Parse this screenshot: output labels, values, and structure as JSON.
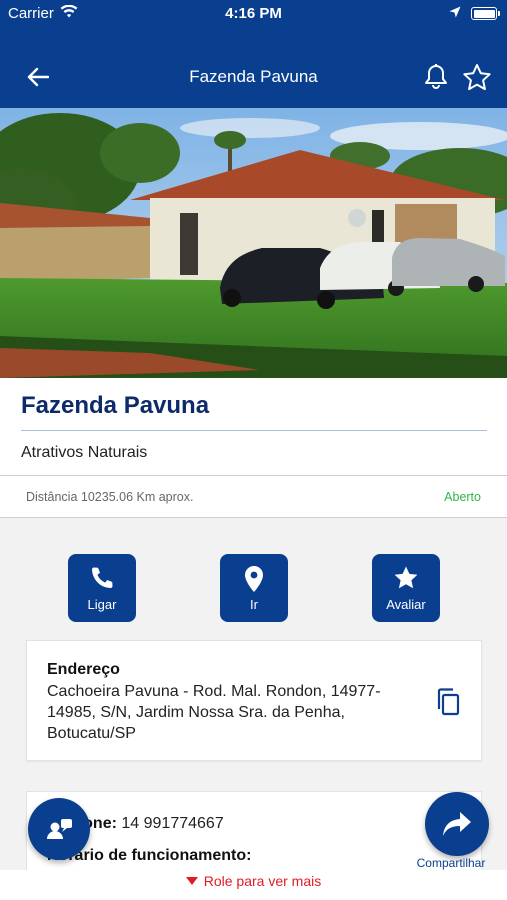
{
  "status_bar": {
    "carrier": "Carrier",
    "time": "4:16 PM"
  },
  "nav": {
    "title": "Fazenda Pavuna",
    "icons": {
      "back": "arrow-left-icon",
      "bell": "bell-icon",
      "star": "star-outline-icon"
    }
  },
  "hero": {
    "image": "farm-house-photo"
  },
  "place": {
    "title": "Fazenda Pavuna",
    "category": "Atrativos Naturais",
    "distance": "Distância 10235.06 Km aprox.",
    "status": "Aberto"
  },
  "actions": [
    {
      "label": "Ligar",
      "icon": "phone-icon"
    },
    {
      "label": "Ir",
      "icon": "location-pin-icon"
    },
    {
      "label": "Avaliar",
      "icon": "star-icon"
    }
  ],
  "address": {
    "title": "Endereço",
    "text": "Cachoeira Pavuna - Rod. Mal. Rondon, 14977-14985, S/N, Jardim Nossa Sra. da Penha, Botucatu/SP",
    "copy_icon": "copy-icon"
  },
  "info": {
    "phone_label": "Telefone:",
    "phone_value": "14 991774667",
    "hours_label": "Horário de funcionamento:"
  },
  "fabs": {
    "mic_icon": "voice-assist-icon",
    "share_icon": "share-arrow-icon",
    "share_label": "Compartilhar"
  },
  "scroll_hint": "Role para ver mais",
  "colors": {
    "primary": "#0a3f8f",
    "title_text": "#0d2b6b",
    "open_green": "#34b34a",
    "hint_red": "#e01b24"
  }
}
